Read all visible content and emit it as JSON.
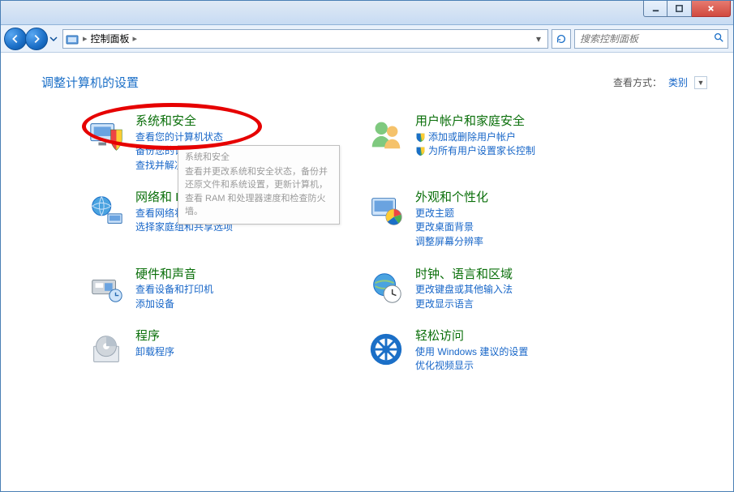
{
  "titlebar": {
    "min_tip": "minimize",
    "max_tip": "maximize",
    "close_tip": "close"
  },
  "nav": {
    "breadcrumb_root": "控制面板",
    "search_placeholder": "搜索控制面板"
  },
  "header": {
    "title": "调整计算机的设置",
    "view_label": "查看方式：",
    "view_value": "类别"
  },
  "tooltip": {
    "title": "系统和安全",
    "body": "查看并更改系统和安全状态，备份并还原文件和系统设置，更新计算机，查看 RAM 和处理器速度和检查防火墙。"
  },
  "cats": [
    {
      "title": "系统和安全",
      "links": [
        {
          "text": "查看您的计算机状态",
          "shield": false
        },
        {
          "text": "备份您的计算机",
          "shield": false
        },
        {
          "text": "查找并解决问题",
          "shield": false
        }
      ]
    },
    {
      "title": "用户帐户和家庭安全",
      "links": [
        {
          "text": "添加或删除用户帐户",
          "shield": true
        },
        {
          "text": "为所有用户设置家长控制",
          "shield": true
        }
      ]
    },
    {
      "title": "网络和 Internet",
      "links": [
        {
          "text": "查看网络状态和任务",
          "shield": false
        },
        {
          "text": "选择家庭组和共享选项",
          "shield": false
        }
      ]
    },
    {
      "title": "外观和个性化",
      "links": [
        {
          "text": "更改主题",
          "shield": false
        },
        {
          "text": "更改桌面背景",
          "shield": false
        },
        {
          "text": "调整屏幕分辨率",
          "shield": false
        }
      ]
    },
    {
      "title": "硬件和声音",
      "links": [
        {
          "text": "查看设备和打印机",
          "shield": false
        },
        {
          "text": "添加设备",
          "shield": false
        }
      ]
    },
    {
      "title": "时钟、语言和区域",
      "links": [
        {
          "text": "更改键盘或其他输入法",
          "shield": false
        },
        {
          "text": "更改显示语言",
          "shield": false
        }
      ]
    },
    {
      "title": "程序",
      "links": [
        {
          "text": "卸载程序",
          "shield": false
        }
      ]
    },
    {
      "title": "轻松访问",
      "links": [
        {
          "text": "使用 Windows 建议的设置",
          "shield": false
        },
        {
          "text": "优化视频显示",
          "shield": false
        }
      ]
    }
  ]
}
